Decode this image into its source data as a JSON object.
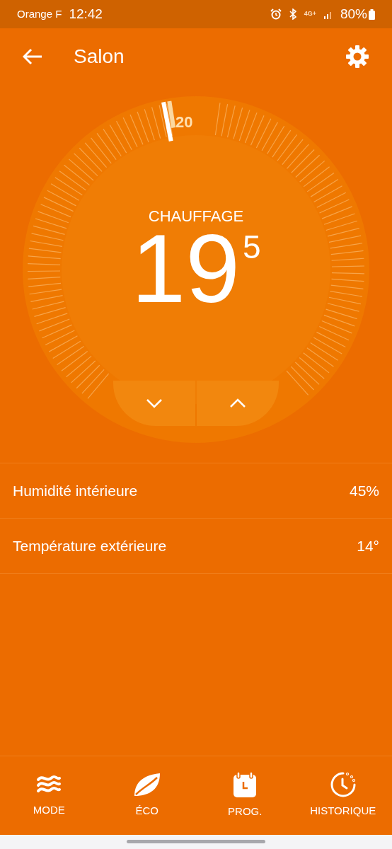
{
  "status_bar": {
    "carrier": "Orange F",
    "time": "12:42",
    "network": "4G+",
    "battery": "80%"
  },
  "header": {
    "title": "Salon"
  },
  "dial": {
    "mode": "CHAUFFAGE",
    "temperature": "19",
    "decimal": "5",
    "setpoint": "20"
  },
  "readings": [
    {
      "label": "Humidité intérieure",
      "value": "45%"
    },
    {
      "label": "Température extérieure",
      "value": "14°"
    }
  ],
  "nav": [
    {
      "kind": "mode",
      "label": "MODE"
    },
    {
      "kind": "eco",
      "label": "ÉCO"
    },
    {
      "kind": "prog",
      "label": "PROG."
    },
    {
      "kind": "history",
      "label": "HISTORIQUE"
    }
  ]
}
